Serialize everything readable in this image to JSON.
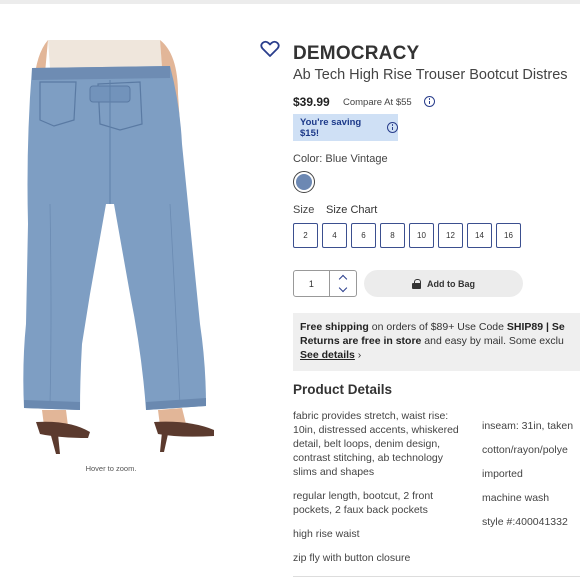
{
  "image": {
    "hover_text": "Hover to zoom."
  },
  "product": {
    "brand": "DEMOCRACY",
    "title": "Ab Tech High Rise Trouser Bootcut Distres",
    "price": "$39.99",
    "compare_label": "Compare At",
    "compare_price": "$55",
    "saving_text": "You're saving $15!",
    "color_label": "Color:",
    "color_value": "Blue Vintage",
    "color_swatch_hex": "#6c88b3",
    "size_label": "Size",
    "size_chart_label": "Size Chart",
    "sizes": [
      "2",
      "4",
      "6",
      "8",
      "10",
      "12",
      "14",
      "16"
    ],
    "quantity": "1",
    "add_to_bag_label": "Add to Bag"
  },
  "shipping": {
    "line1_bold": "Free shipping",
    "line1_text": " on orders of $89+ Use Code ",
    "line1_code": "SHIP89",
    "line1_sep": " | Se",
    "line2_bold": "Returns are free in store",
    "line2_text": " and easy by mail. Some exclu",
    "see_details": "See details",
    "see_details_chevron": "›"
  },
  "details": {
    "title": "Product Details",
    "left": [
      "fabric provides stretch, waist rise: 10in, distressed accents, whiskered detail, belt loops, denim design, contrast stitching, ab technology slims and shapes",
      "regular length, bootcut, 2 front pockets, 2 faux back pockets",
      "high rise waist",
      "zip fly with button closure"
    ],
    "right": [
      "inseam: 31in, taken",
      "cotton/rayon/polye",
      "imported",
      "machine wash",
      "style #:400041332"
    ]
  },
  "colors": {
    "accent": "#2a3e8c",
    "saving_bg": "#cfe0f5",
    "shipping_bg": "#efefef",
    "denim": "#6c88b3"
  },
  "icons": [
    "heart-icon",
    "info-icon",
    "lock-icon",
    "chevron-up-icon",
    "chevron-down-icon",
    "chevron-right-icon"
  ]
}
